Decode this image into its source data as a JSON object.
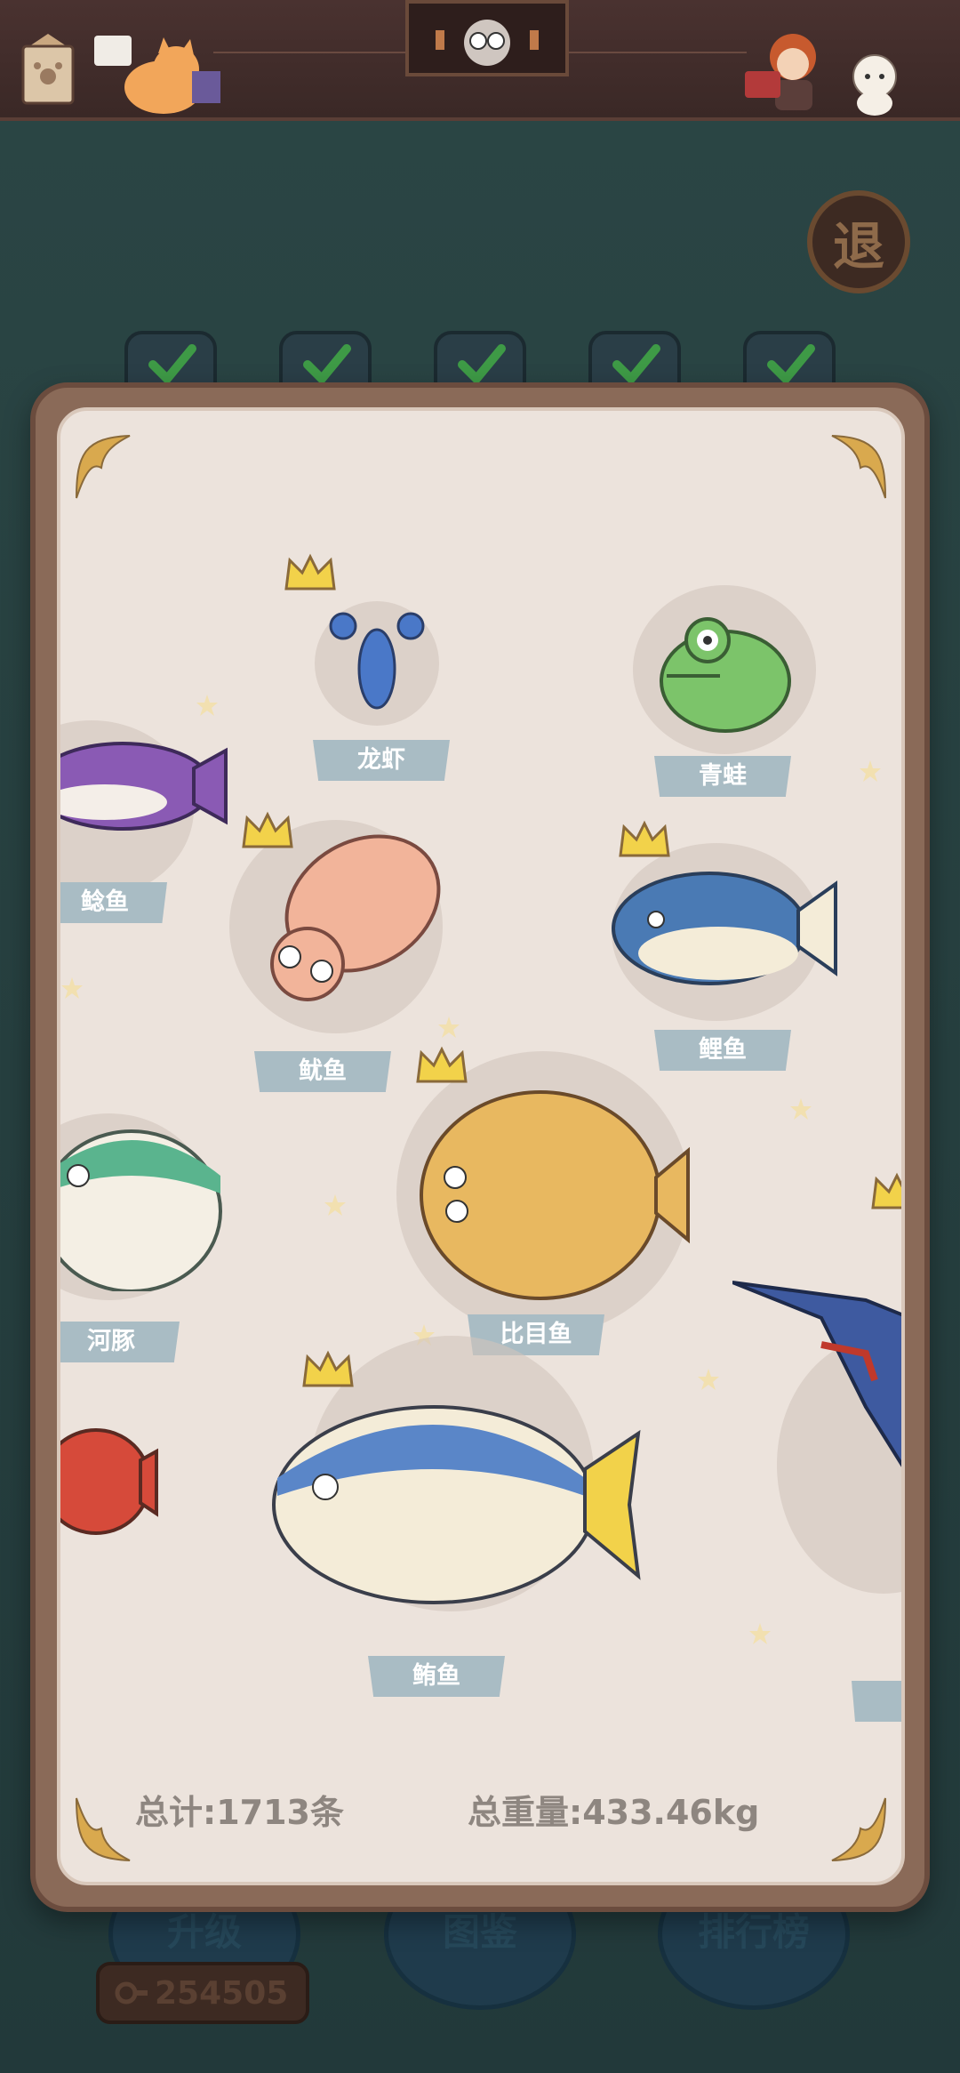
{
  "header": {
    "icons": [
      "book-icon",
      "cat-reading-icon",
      "owl-portrait-icon",
      "fisher-girl-icon",
      "white-cat-icon"
    ]
  },
  "exit_button": {
    "label": "退"
  },
  "tabs": [
    {
      "state": "checked"
    },
    {
      "state": "checked"
    },
    {
      "state": "checked"
    },
    {
      "state": "checked"
    },
    {
      "state": "checked"
    }
  ],
  "collection": {
    "fish": [
      {
        "name": "龙虾",
        "crown": true
      },
      {
        "name": "青蛙",
        "crown": false
      },
      {
        "name": "鲶鱼",
        "crown": false
      },
      {
        "name": "鱿鱼",
        "crown": true
      },
      {
        "name": "鲤鱼",
        "crown": true
      },
      {
        "name": "比目鱼",
        "crown": true
      },
      {
        "name": "河豚",
        "crown": false
      },
      {
        "name": "鲔鱼",
        "crown": true
      }
    ],
    "total_count": "总计:1713条",
    "total_weight": "总重量:433.46kg"
  },
  "bottom_nav": [
    {
      "label": "升级"
    },
    {
      "label": "图鉴"
    },
    {
      "label": "排行榜"
    }
  ],
  "coins": {
    "value": "254505"
  },
  "colors": {
    "card_bg": "#ece3dc",
    "label_bg": "#a9bcc4",
    "frame": "#8a6a58",
    "crown": "#f2d24a"
  }
}
